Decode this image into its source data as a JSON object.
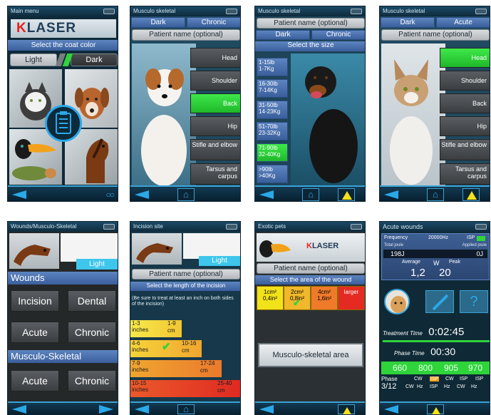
{
  "screen1": {
    "header": "Main menu",
    "logo_k": "K",
    "logo_rest": "LASER",
    "prompt": "Select the coat color",
    "light": "Light",
    "dark": "Dark"
  },
  "screen2": {
    "header": "Musculo skeletal",
    "tab1": "Dark",
    "tab2": "Chronic",
    "patient": "Patient name (optional)",
    "areas": [
      "Head",
      "Shoulder",
      "Back",
      "Hip",
      "Stifle and elbow",
      "Tarsus and carpus"
    ]
  },
  "screen3": {
    "header": "Musculo skeletal",
    "patient": "Patient name (optional)",
    "tab1": "Dark",
    "tab2": "Chronic",
    "prompt": "Select the size",
    "sizes": [
      [
        "1-15lb",
        "1-7Kg"
      ],
      [
        "16-30lb",
        "7-14Kg"
      ],
      [
        "31-50lb",
        "14-23Kg"
      ],
      [
        "51-70lb",
        "23-32Kg"
      ],
      [
        "71-90lb",
        "32-40Kg"
      ],
      [
        ">90lb",
        ">40Kg"
      ]
    ]
  },
  "screen4": {
    "header": "Musculo skeletal",
    "tab1": "Dark",
    "tab2": "Acute",
    "patient": "Patient name (optional)",
    "areas": [
      "Head",
      "Shoulder",
      "Back",
      "Hip",
      "Stifle and elbow",
      "Tarsus and carpus"
    ]
  },
  "screen5": {
    "header": "Wounds/Musculo-Skeletal",
    "light": "Light",
    "wounds": "Wounds",
    "incision": "Incision",
    "dental": "Dental",
    "acute": "Acute",
    "chronic": "Chronic",
    "musculo": "Musculo-Skeletal",
    "acute2": "Acute",
    "chronic2": "Chronic"
  },
  "screen6": {
    "header": "Incision site",
    "light": "Light",
    "patient": "Patient name (optional)",
    "prompt": "Select the length of the incision",
    "note": "(Be sure to treat at least an inch on both sides of the incision)",
    "rows": [
      [
        "1-3",
        "inches",
        "1-9",
        "cm"
      ],
      [
        "4-6",
        "inches",
        "10-16",
        "cm"
      ],
      [
        "7-9",
        "inches",
        "17-24",
        "cm"
      ],
      [
        "10-15",
        "inches",
        "25-40",
        "cm"
      ]
    ]
  },
  "screen7": {
    "header": "Exotic pets",
    "logo_k": "K",
    "logo_rest": "LASER",
    "patient": "Patient name (optional)",
    "prompt": "Select the area of the wound",
    "cells": [
      [
        "1cm²",
        "0,4in²"
      ],
      [
        "2cm²",
        "0,8in²"
      ],
      [
        "4cm²",
        "1,6in²"
      ],
      [
        "larger",
        ""
      ]
    ],
    "button": "Musculo-skeletal area"
  },
  "screen8": {
    "header": "Acute wounds",
    "frequency_label": "Frequency",
    "frequency_value": "20000Hz",
    "isp": "ISP",
    "total_joule": "Total joule",
    "applied_joule": "Applied joule",
    "total_value": "198J",
    "applied_value": "0J",
    "average": "Average",
    "w": "W",
    "peak": "Peak",
    "avg_value": "1,2",
    "peak_value": "20",
    "treatment_label": "Treatment Time",
    "treatment_value": "0:02:45",
    "phase_time_label": "Phase Time",
    "phase_time_value": "00:30",
    "freqs": [
      "660",
      "800",
      "905",
      "970"
    ],
    "phase_label": "Phase",
    "phase_value": "3/12",
    "modes_top": [
      "CW",
      "ISP",
      "CW",
      "ISP",
      "ISP"
    ],
    "modes_bottom": [
      "CW",
      "Hz",
      "ISP",
      "Hz",
      "CW",
      "Hz"
    ]
  },
  "colors": {
    "accent": "#2aa8e8",
    "green": "#2fd43a",
    "yellow": "#f2e21a",
    "panel_blue": "#4a72b0"
  }
}
